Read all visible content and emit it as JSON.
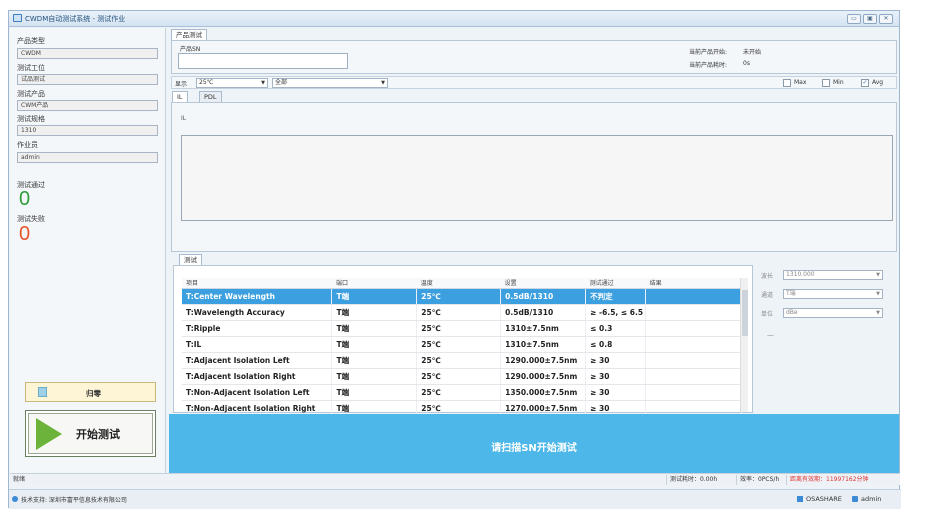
{
  "window": {
    "title": "CWDM自动测试系统 - 测试作业",
    "btn_min": "▭",
    "btn_max": "▣",
    "btn_close": "✕"
  },
  "left": {
    "product_type_label": "产品类型",
    "product_type_value": "CWDM",
    "station_label": "测试工位",
    "station_value": "试品测试",
    "product_label": "测试产品",
    "product_value": "CWM产品",
    "spec_label": "测试规格",
    "spec_value": "1310",
    "operator_label": "作业员",
    "operator_value": "admin",
    "pass_label": "测试通过",
    "pass_count": "0",
    "fail_label": "测试失败",
    "fail_count": "0",
    "return_label": "归零",
    "start_label": "开始测试"
  },
  "product_test": {
    "group_title": "产品测试",
    "sn_label": "产品SN",
    "sn_value": "",
    "start_label": "当前产品开始:",
    "start_value": "未开始",
    "elapsed_label": "当前产品耗时:",
    "elapsed_value": "0s"
  },
  "display_bar": {
    "label": "显示",
    "temp_select": "25℃",
    "port_select": "全部",
    "max_label": "Max",
    "max_checked": false,
    "min_label": "Min",
    "min_checked": false,
    "avg_label": "Avg",
    "avg_checked": true
  },
  "chart_tabs": [
    "IL",
    "PDL"
  ],
  "chart_panel_label": "IL",
  "test_tab": "测试",
  "grid": {
    "columns": [
      "项目",
      "端口",
      "温度",
      "设置",
      "测试通过",
      "结果"
    ],
    "rows": [
      [
        "T:Center Wavelength",
        "T端",
        "25℃",
        "0.5dB/1310",
        "不判定",
        ""
      ],
      [
        "T:Wavelength Accuracy",
        "T端",
        "25℃",
        "0.5dB/1310",
        "≥ -6.5, ≤ 6.5",
        ""
      ],
      [
        "T:Ripple",
        "T端",
        "25℃",
        "1310±7.5nm",
        "≤ 0.3",
        ""
      ],
      [
        "T:IL",
        "T端",
        "25℃",
        "1310±7.5nm",
        "≤ 0.8",
        ""
      ],
      [
        "T:Adjacent Isolation Left",
        "T端",
        "25℃",
        "1290.000±7.5nm",
        "≥ 30",
        ""
      ],
      [
        "T:Adjacent Isolation Right",
        "T端",
        "25℃",
        "1290.000±7.5nm",
        "≥ 30",
        ""
      ],
      [
        "T:Non-Adjacent Isolation Left",
        "T端",
        "25℃",
        "1350.000±7.5nm",
        "≥ 30",
        ""
      ],
      [
        "T:Non-Adjacent Isolation Right",
        "T端",
        "25℃",
        "1270.000±7.5nm",
        "≥ 30",
        ""
      ]
    ]
  },
  "side_form": {
    "wave_label": "波长",
    "wave_value": "1310.000",
    "channel_label": "通道",
    "channel_value": "T端",
    "unit_label": "单位",
    "unit_value": "dBe",
    "dash": "—"
  },
  "scan_prompt": "请扫描SN开始测试",
  "status": {
    "left": "就绪",
    "elapsed": "测试耗时：0.00h",
    "efficiency": "效率：0PCS/h",
    "valid_time": "距离有效期：11997162分钟"
  },
  "footer": {
    "support": "技术支持: 深圳市富平信息技术有限公司",
    "brand": "OSASHARE",
    "user": "admin"
  },
  "colors": {
    "accent": "#4cb7e8",
    "selected_row": "#3b9fe0",
    "pass": "#2e9e3a",
    "fail": "#e8542a"
  }
}
